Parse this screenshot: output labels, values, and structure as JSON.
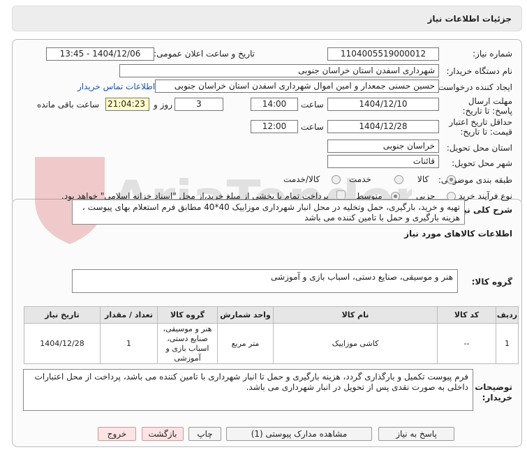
{
  "header": {
    "title": "جزئیات اطلاعات نیاز"
  },
  "form": {
    "need_number_label": "شماره نیاز:",
    "need_number": "1104005519000012",
    "announce_label": "تاریخ و ساعت اعلان عمومی:",
    "announce_value": "1404/12/06 - 13:45",
    "buyer_org_label": "نام دستگاه خریدار:",
    "buyer_org": "شهرداری اسفدن استان خراسان جنوبی",
    "requester_label": "ایجاد کننده درخواست:",
    "requester": "حسین حسنی جمعدار و امین اموال شهرداری اسفدن استان خراسان جنوبی",
    "contact_link": "اطلاعات تماس خریدار",
    "deadline_label": "مهلت ارسال پاسخ: تا تاریخ:",
    "deadline_date": "1404/12/10",
    "time_label": "ساعت",
    "deadline_time": "14:00",
    "days": "3",
    "days_label": "روز و",
    "remaining_time": "21:04:23",
    "remaining_label": "ساعت باقی مانده",
    "validity_label": "حداقل تاریخ اعتبار قیمت: تا تاریخ:",
    "validity_date": "1404/12/28",
    "validity_time": "12:00",
    "province_label": "استان محل تحویل:",
    "province": "خراسان جنوبی",
    "city_label": "شهر محل تحویل:",
    "city": "قائنات",
    "category_label": "طبقه بندی موضوعی:",
    "category_options": [
      "کالا",
      "خدمت",
      "کالا/خدمت"
    ],
    "process_label": "نوع فرآیند خرید :",
    "process_options": [
      "جزیی",
      "متوسط"
    ],
    "payment_note": "پرداخت تمام یا بخشی از مبلغ خرید،از محل \"اسناد خزانه اسلامی\" خواهد بود."
  },
  "details": {
    "summary_label": "شرح کلی نیاز:",
    "summary": "تهیه و خرید، بارگیری، حمل وتخلیه در محل انبار شهرداری موزاییک 40*40 مطابق فرم استعلام بهای پیوست ، هزینه بارگیری و حمل با تامین کننده می باشد",
    "goods_info_title": "اطلاعات کالاهای مورد نیاز",
    "goods_group_label": "گروه کالا:",
    "goods_group": "هنر و موسیقی، صنایع دستی، اسباب بازی و آموزشی",
    "table": {
      "headers": [
        "ردیف",
        "کد کالا",
        "نام کالا",
        "واحد شمارش",
        "گروه کالا",
        "تعداد / مقدار",
        "تاریخ نیاز"
      ],
      "rows": [
        [
          "1",
          "--",
          "کاشی موزاییک",
          "متر مربع",
          "هنر و موسیقی، صنایع دستی، اسباب بازی و آموزشی",
          "1",
          "1404/12/28"
        ]
      ]
    },
    "buyer_notes_label": "توضیحات خریدار:",
    "buyer_notes": "فرم پیوست تکمیل و بارگذاری گردد، هزینه بارگیری و حمل تا انبار شهرداری با تامین کننده می باشد، پرداخت از محل اعتبارات داخلی به صورت نقدی پس از تحویل در انبار شهرداری می باشد."
  },
  "buttons": {
    "reply": "پاسخ به نیاز",
    "attachments": "مشاهده مدارک پیوستی (1)",
    "print": "چاپ",
    "back": "بازگشت",
    "exit": "خروج"
  },
  "watermark": {
    "text": "AriaTender.neT"
  },
  "colors": {
    "link": "#2255aa",
    "highlight": "#ffffc8",
    "exit_button": "#fde3e3"
  }
}
